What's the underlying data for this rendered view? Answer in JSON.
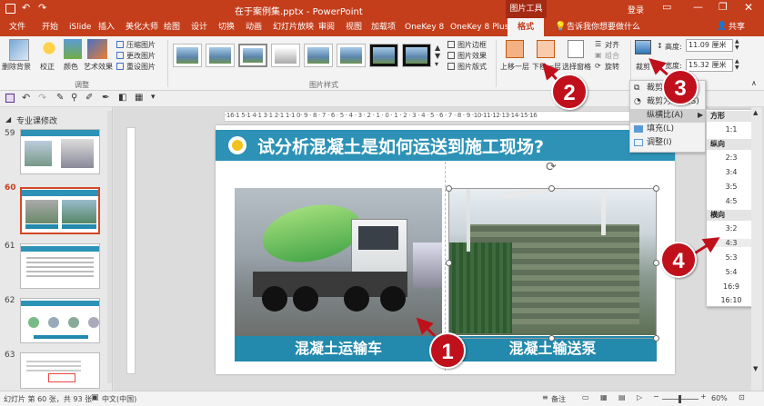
{
  "window": {
    "title": "在于案例集.pptx - PowerPoint",
    "context_tool": "图片工具",
    "login": "登录",
    "share": "共享"
  },
  "tabs": [
    "文件",
    "开始",
    "iSlide",
    "插入",
    "美化大师",
    "绘图",
    "设计",
    "切换",
    "动画",
    "幻灯片放映",
    "审阅",
    "视图",
    "加载项",
    "OneKey 8",
    "OneKey 8 Plus",
    "格式"
  ],
  "tell_me": "告诉我你想要做什么",
  "ribbon": {
    "remove_bg": "删除背景",
    "correct": "校正",
    "color": "颜色",
    "art_effect": "艺术效果",
    "compress": "压缩图片",
    "change": "更改图片",
    "reset": "重设图片",
    "adjust_group": "调整",
    "style_group": "图片样式",
    "border": "图片边框",
    "effect": "图片效果",
    "layout": "图片版式",
    "bring_forward": "上移一层",
    "send_backward": "下移一层",
    "selection_pane": "选择窗格",
    "align": "对齐",
    "group": "组合",
    "rotate": "旋转",
    "crop": "裁剪",
    "height_label": "高度:",
    "height_value": "11.09 厘米",
    "width_label": "宽度:",
    "width_value": "15.32 厘米"
  },
  "crop_menu": {
    "crop": "裁剪(C)",
    "crop_shape": "裁剪为形状(S)",
    "aspect": "纵横比(A)",
    "fill": "填充(L)",
    "fit": "调整(I)"
  },
  "aspect_menu": {
    "square_hdr": "方形",
    "square": [
      "1:1"
    ],
    "portrait_hdr": "纵向",
    "portrait": [
      "2:3",
      "3:4",
      "3:5",
      "4:5"
    ],
    "landscape_hdr": "横向",
    "landscape": [
      "3:2",
      "4:3",
      "5:3",
      "5:4",
      "16:9",
      "16:10"
    ]
  },
  "left_pane": {
    "section": "专业课修改",
    "slides": [
      "59",
      "60",
      "61",
      "62",
      "63"
    ]
  },
  "ruler": "·16·1 5·1 4·1 3·1 2·1 1·1 0· 9 · 8 · 7 · 6 · 5 · 4 · 3 · 2 · 1 · 0 · 1 · 2 · 3 · 4 · 5 · 6 · 7 · 8 · 9 ·10·11·12·13·14·15·16",
  "slide": {
    "title": "试分析混凝土是如何运送到施工现场?",
    "left_caption": "混凝土运输车",
    "right_caption": "混凝土输送泵"
  },
  "badges": [
    "1",
    "2",
    "3",
    "4"
  ],
  "status": {
    "slide_info": "幻灯片 第 60 张，共 93 张",
    "language": "中文(中国)",
    "notes": "备注",
    "zoom": "60%"
  },
  "colors": {
    "accent": "#c43e1c",
    "slide_title_bg": "#2d92b6",
    "caption_bg": "#2389ad",
    "badge": "#c0101c"
  }
}
